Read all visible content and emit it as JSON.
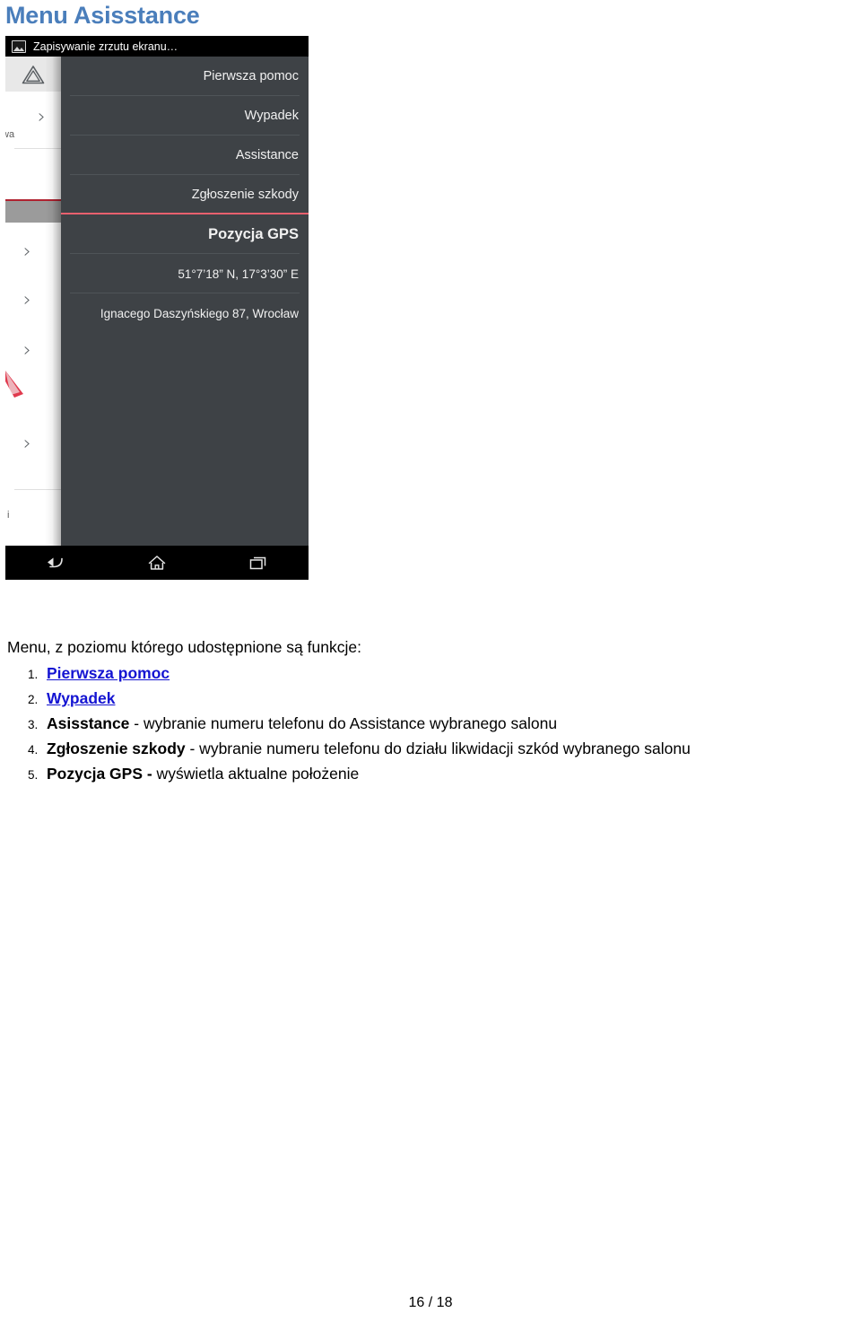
{
  "page": {
    "title": "Menu Asisstance",
    "footer": "16 / 18",
    "title_color": "#4a7ebb"
  },
  "screenshot": {
    "status_bar": {
      "icon": "screenshot-image-icon",
      "text": "Zapisywanie zrzutu ekranu…"
    },
    "background_app": {
      "warning_icon": "hazard-triangle-icon",
      "chevron": "›",
      "partial_label_top": "wa",
      "partial_label_bottom": "i"
    },
    "menu": {
      "items": [
        {
          "label": "Pierwsza pomoc",
          "style": "normal"
        },
        {
          "label": "Wypadek",
          "style": "normal"
        },
        {
          "label": "Assistance",
          "style": "normal"
        },
        {
          "label": "Zgłoszenie szkody",
          "style": "normal"
        },
        {
          "label": "Pozycja GPS",
          "style": "bold"
        },
        {
          "label": "51°7’18”  N, 17°3’30”  E",
          "style": "small"
        },
        {
          "label": "Ignacego Daszyńskiego 87, Wrocław",
          "style": "small"
        }
      ],
      "accent_color": "#e8606e",
      "panel_color": "#3e4246"
    },
    "nav_bar": {
      "back": "back-icon",
      "home": "home-icon",
      "recents": "recent-apps-icon"
    }
  },
  "content": {
    "intro": "Menu, z poziomu którego udostępnione są funkcje:",
    "items": [
      {
        "term": "Pierwsza pomoc",
        "term_style": "link",
        "rest": ""
      },
      {
        "term": "Wypadek",
        "term_style": "link",
        "rest": ""
      },
      {
        "term": "Asisstance",
        "term_style": "bold",
        "rest": " - wybranie numeru telefonu do Assistance wybranego salonu"
      },
      {
        "term": "Zgłoszenie szkody",
        "term_style": "bold",
        "rest": " - wybranie numeru telefonu do działu likwidacji szkód wybranego salonu"
      },
      {
        "term": "Pozycja GPS -",
        "term_style": "bold",
        "rest": " wyświetla aktualne położenie"
      }
    ]
  }
}
